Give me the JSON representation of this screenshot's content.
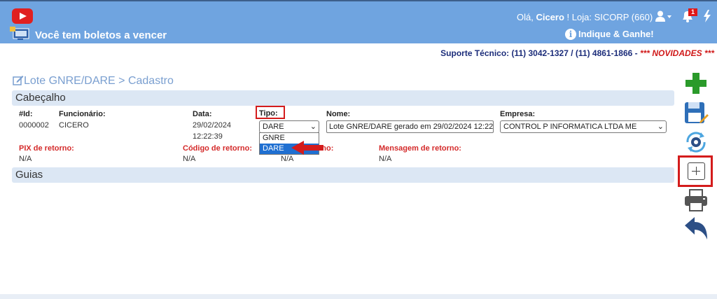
{
  "header": {
    "boleto_text": "Você tem boletos a vencer",
    "greeting_prefix": "Olá, ",
    "user_name": "Cicero",
    "greeting_suffix": " !  Loja: SICORP (660)",
    "notification_count": "1",
    "indique_label": "Indique & Ganhe!"
  },
  "support": {
    "text": "Suporte Técnico: (11) 3042-1327 / (11) 4861-1866 - ",
    "novidades": "*** NOVIDADES ***"
  },
  "breadcrumb": "Lote GNRE/DARE > Cadastro",
  "sections": {
    "cabecalho": "Cabeçalho",
    "guias": "Guias"
  },
  "form": {
    "id_label": "#Id:",
    "id_value": "0000002",
    "funcionario_label": "Funcionário:",
    "funcionario_value": "CICERO",
    "data_label": "Data:",
    "data_value_date": "29/02/2024",
    "data_value_time": "12:22:39",
    "tipo_label": "Tipo:",
    "tipo_value": "DARE",
    "tipo_options": [
      "GNRE",
      "DARE"
    ],
    "nome_label": "Nome:",
    "nome_value": "Lote GNRE/DARE gerado em 29/02/2024 12:22:",
    "empresa_label": "Empresa:",
    "empresa_value": "CONTROL P INFORMATICA LTDA ME",
    "pix_label": "PIX de retorno:",
    "pix_value": "N/A",
    "codigo_label": "Código de retorno:",
    "codigo_value": "N/A",
    "retorno_label": "rno:",
    "retorno_value": "N/A",
    "mensagem_label": "Mensagem de retorno:",
    "mensagem_value": "N/A"
  },
  "colors": {
    "header_bg": "#6fa4e0",
    "highlight_red": "#d41c1c",
    "section_bg": "#dce7f4"
  },
  "icons": [
    "youtube-icon",
    "boleto-icon",
    "user-icon",
    "bell-icon",
    "bolt-icon",
    "info-icon",
    "edit-icon",
    "add-icon",
    "save-icon",
    "refresh-settings-icon",
    "add-guia-icon",
    "print-icon",
    "back-icon"
  ]
}
